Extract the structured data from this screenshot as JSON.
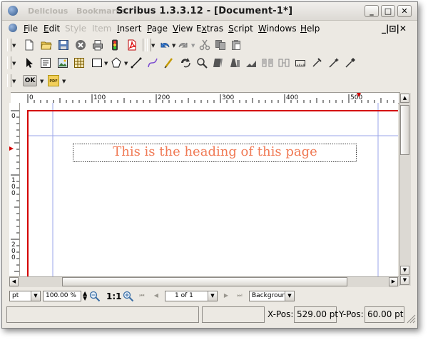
{
  "titlebar": {
    "ghost_items": [
      "Delicious",
      "Bookmarks"
    ],
    "title": "Scribus 1.3.3.12 - [Document-1*]",
    "buttons": [
      "_",
      "□",
      "✕"
    ]
  },
  "menubar": {
    "items": [
      {
        "pre": "",
        "u": "F",
        "post": "ile"
      },
      {
        "pre": "",
        "u": "E",
        "post": "dit"
      },
      {
        "pre": "",
        "u": "S",
        "post": "tyle"
      },
      {
        "pre": "",
        "u": "I",
        "post": "tem"
      },
      {
        "pre": "",
        "u": "I",
        "post": "nsert"
      },
      {
        "pre": "",
        "u": "P",
        "post": "age"
      },
      {
        "pre": "",
        "u": "V",
        "post": "iew"
      },
      {
        "pre": "E",
        "u": "x",
        "post": "tras"
      },
      {
        "pre": "",
        "u": "S",
        "post": "cript"
      },
      {
        "pre": "",
        "u": "W",
        "post": "indows"
      },
      {
        "pre": "",
        "u": "H",
        "post": "elp"
      }
    ],
    "mdi_controls": "_|⊡|✕"
  },
  "preflight": {
    "ok_label": "OK"
  },
  "ruler": {
    "h_labels": [
      "0",
      "100",
      "200",
      "300",
      "400",
      "500"
    ],
    "v_labels": [
      "0",
      "100",
      "200"
    ]
  },
  "document": {
    "heading": "This is the heading of this page",
    "heading_color": "#f07a55",
    "page_border_color": "#d40000",
    "guide_color": "#9aa6e8"
  },
  "controls": {
    "unit": "pt",
    "zoom": "100.00 %",
    "zoom_ratio": "1:1",
    "page_of": "1 of 1",
    "layer": "Background"
  },
  "status": {
    "xpos_label": "X-Pos:",
    "xpos_value": "529.00 pt",
    "ypos_label": "Y-Pos:",
    "ypos_value": "60.00 pt"
  }
}
